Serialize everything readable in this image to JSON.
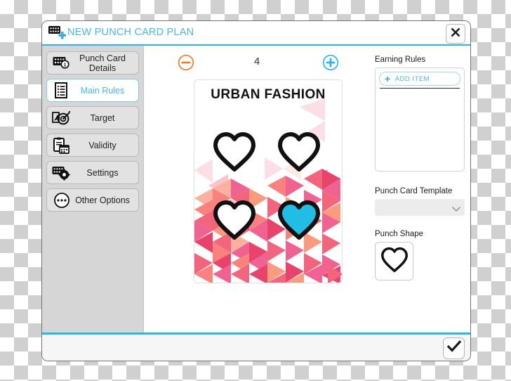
{
  "window": {
    "title": "NEW PUNCH CARD PLAN",
    "title_icon": "punch-card-plus-icon",
    "close_icon": "close-x-icon",
    "confirm_icon": "checkmark-icon",
    "accent_color": "#29b6e8",
    "title_color": "#4cb5e0"
  },
  "sidebar": {
    "items": [
      {
        "label": "Punch Card Details",
        "icon": "punch-card-info-icon",
        "selected": false
      },
      {
        "label": "Main Rules",
        "icon": "list-document-icon",
        "selected": true
      },
      {
        "label": "Target",
        "icon": "target-dart-icon",
        "selected": false
      },
      {
        "label": "Validity",
        "icon": "clipboard-calendar-icon",
        "selected": false
      },
      {
        "label": "Settings",
        "icon": "punch-card-gear-icon",
        "selected": false
      },
      {
        "label": "Other Options",
        "icon": "ellipsis-circle-icon",
        "selected": false
      }
    ]
  },
  "center": {
    "stepper": {
      "count": "4",
      "minus_icon": "minus-circle-icon",
      "plus_icon": "plus-circle-icon",
      "minus_color": "#ef7c29",
      "plus_color": "#29b6e8"
    },
    "card": {
      "brand": "URBAN FASHION",
      "punch_shape": "heart",
      "total_punches": 4,
      "punched": 1,
      "punched_color": "#22bde4",
      "outline_color": "#111111",
      "mosaic_colors": [
        "#f3647d",
        "#ef5a6e",
        "#f9827e",
        "#fa9a7e",
        "#f06292",
        "#e8436a",
        "#fbb0a0",
        "#f7768c"
      ]
    }
  },
  "right_panel": {
    "earning_rules_label": "Earning Rules",
    "add_item_label": "ADD ITEM",
    "add_item_icon": "plus-icon",
    "template_label": "Punch Card Template",
    "template_value": "",
    "template_chevron_icon": "chevron-down-icon",
    "punch_shape_label": "Punch Shape",
    "punch_shape_icon": "heart-outline-icon"
  }
}
